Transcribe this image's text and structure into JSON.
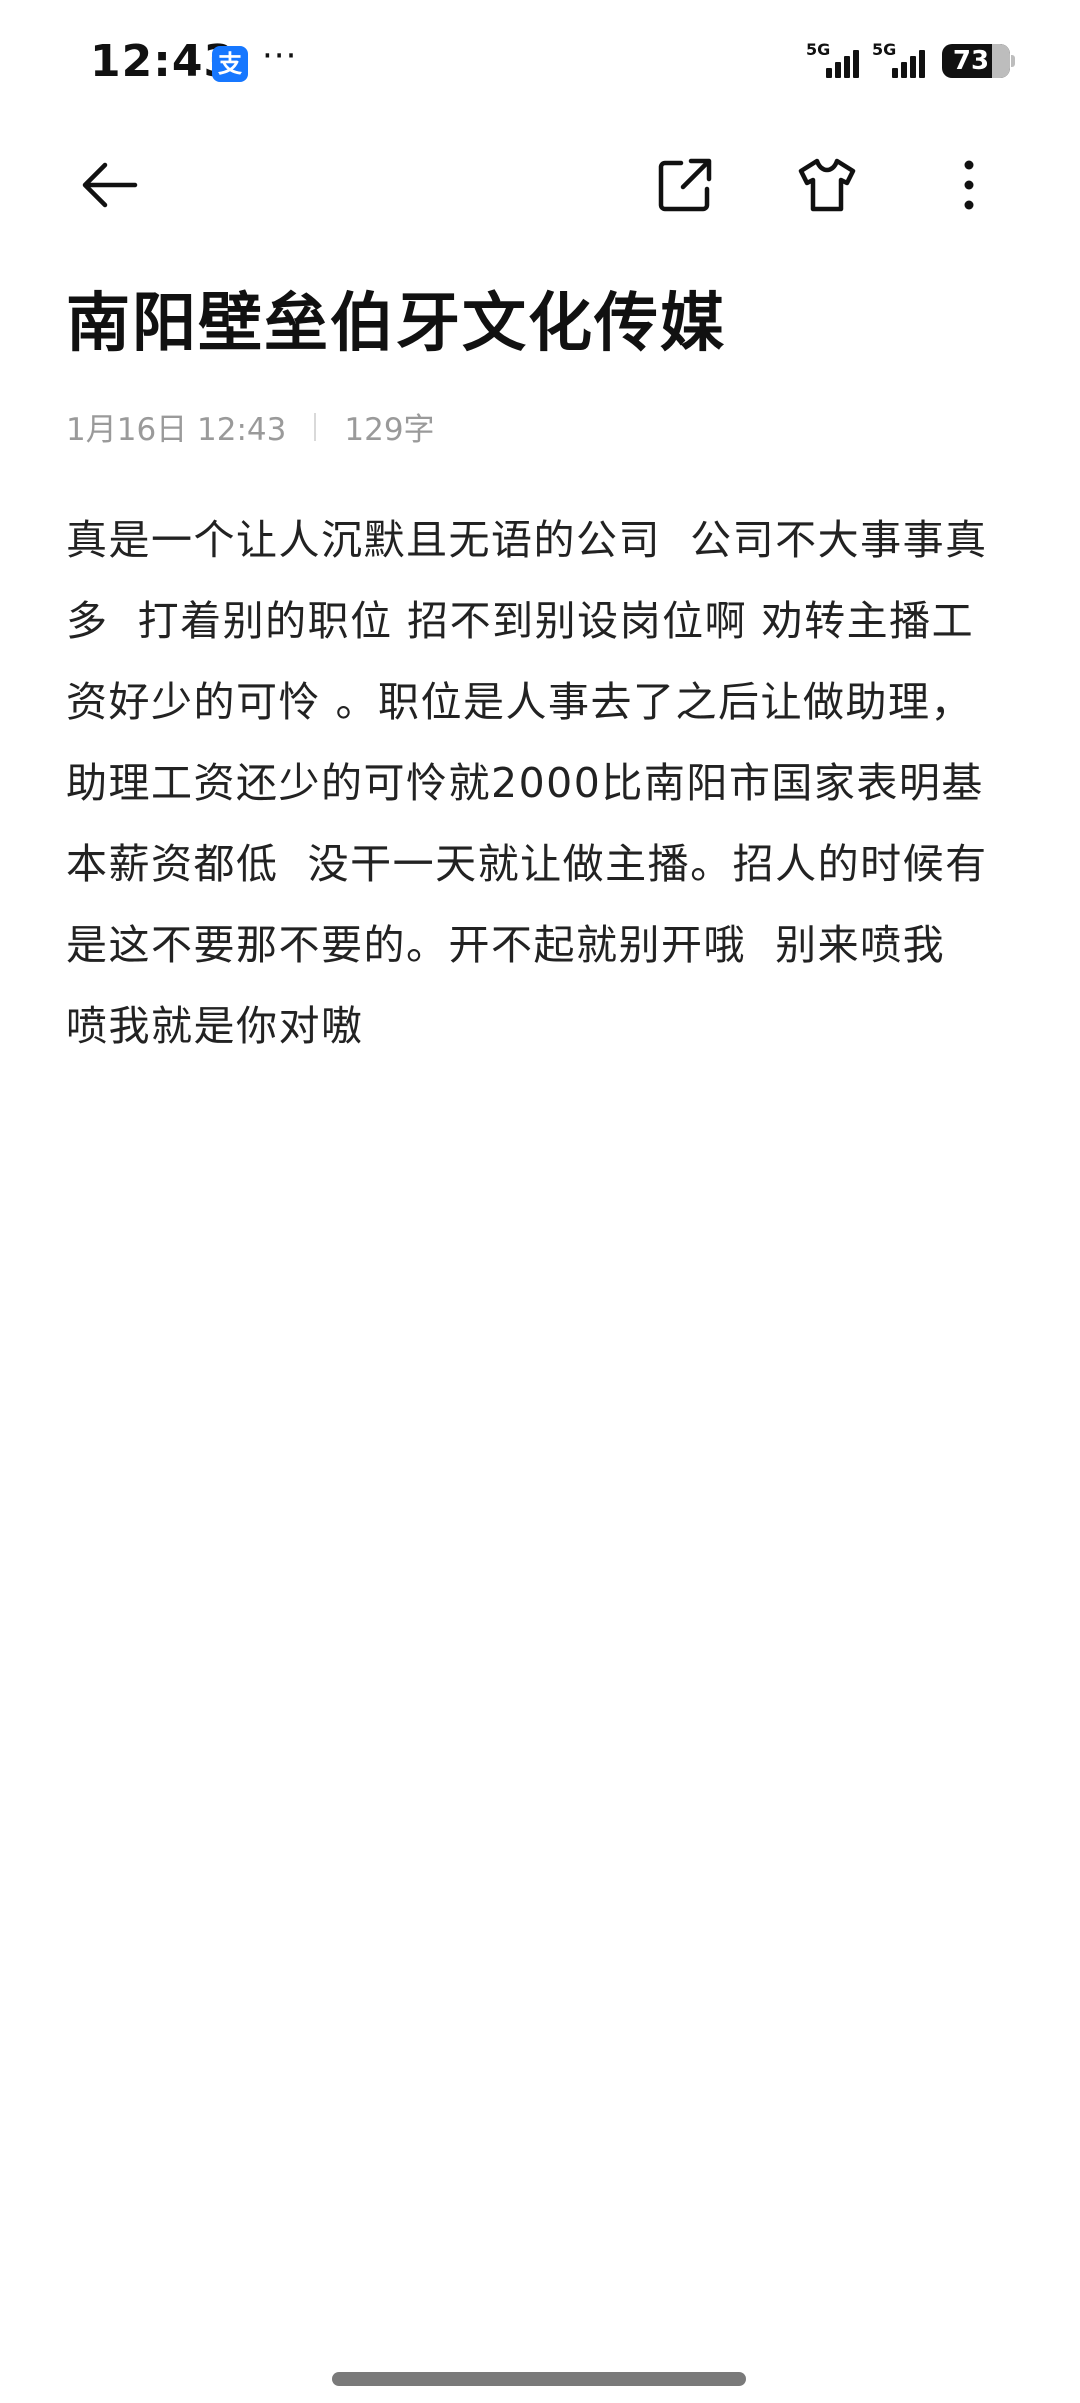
{
  "status_bar": {
    "time": "12:43",
    "app_badge": "支",
    "more_dots": "···",
    "signal_1_label": "5G",
    "signal_2_label": "5G",
    "battery_level": "73"
  },
  "toolbar": {
    "back_icon": "arrow-left-icon",
    "share_icon": "share-icon",
    "theme_icon": "tshirt-icon",
    "more_icon": "more-vertical-icon"
  },
  "note": {
    "title": "南阳壁垒伯牙文化传媒",
    "date": "1月16日 12:43",
    "word_count": "129字",
    "body_lines": [
      "真是一个让人沉默且无语的公司  公司不大事事真",
      "多  打着别的职位 招不到别设岗位啊 劝转主播工",
      "资好少的可怜 。职位是人事去了之后让做助理，",
      "助理工资还少的可怜就2000比南阳市国家表明基",
      "本薪资都低  没干一天就让做主播。招人的时候有",
      "是这不要那不要的。开不起就别开哦  别来喷我",
      "喷我就是你对嗷"
    ]
  },
  "colors": {
    "text": "#111111",
    "meta": "#9a9a9a",
    "background": "#ffffff",
    "alipay_blue": "#1677ff"
  }
}
